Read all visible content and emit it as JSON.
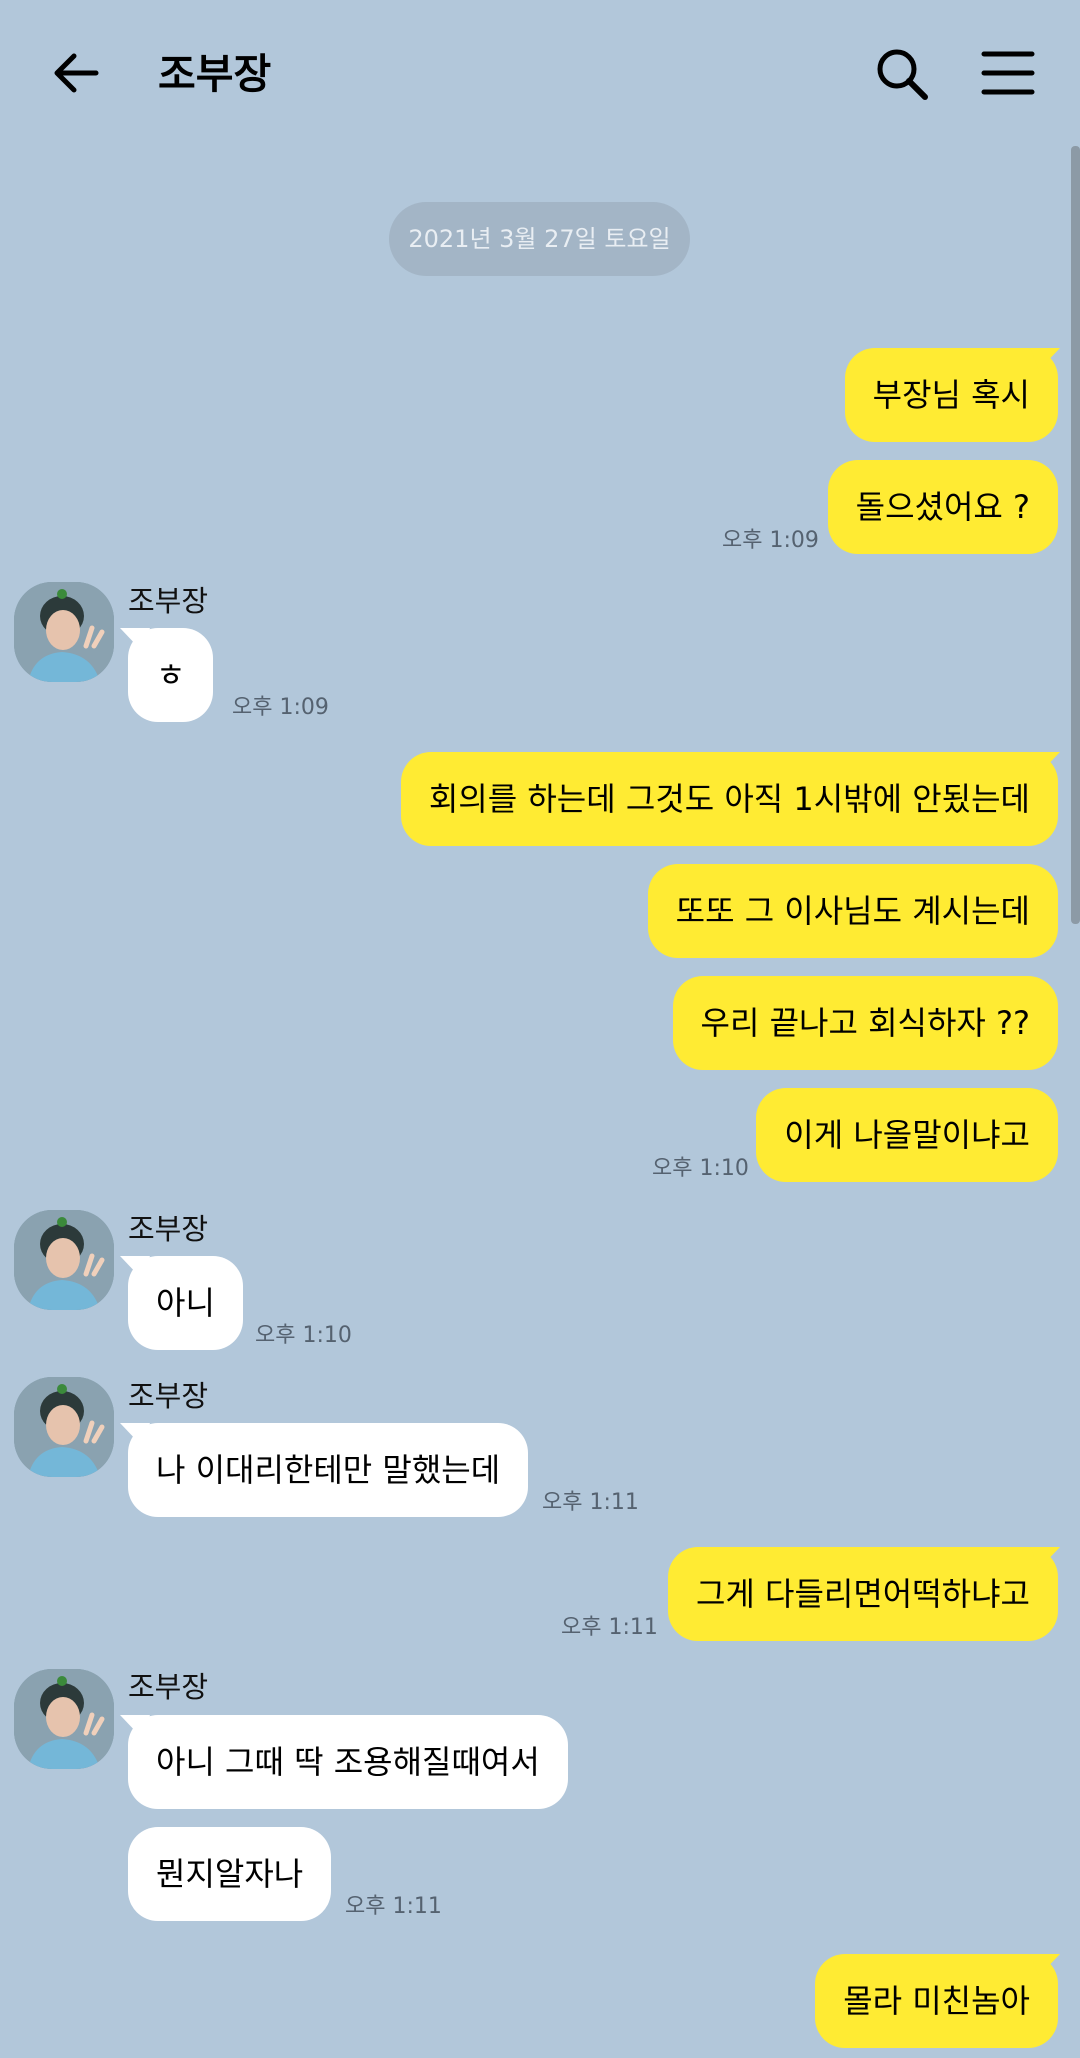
{
  "header": {
    "title": "조부장"
  },
  "date_divider": "2021년 3월 27일 토요일",
  "messages": {
    "m1": {
      "text": "부장님 혹시"
    },
    "m2": {
      "text": "돌으셨어요 ?",
      "time": "오후 1:09"
    },
    "g1": {
      "sender": "조부장",
      "text": "ㅎ",
      "time": "오후 1:09"
    },
    "m3": {
      "text": "회의를 하는데 그것도 아직 1시밖에 안됬는데"
    },
    "m4": {
      "text": "또또 그 이사님도 계시는데"
    },
    "m5": {
      "text": "우리 끝나고 회식하자 ??"
    },
    "m6": {
      "text": "이게 나올말이냐고",
      "time": "오후 1:10"
    },
    "g2": {
      "sender": "조부장",
      "text": "아니",
      "time": "오후 1:10"
    },
    "g3": {
      "sender": "조부장",
      "text": "나 이대리한테만 말했는데",
      "time": "오후 1:11"
    },
    "m7": {
      "text": "그게 다들리면어떡하냐고",
      "time": "오후 1:11"
    },
    "g4": {
      "sender": "조부장",
      "text": "아니 그때 딱 조용해질때여서"
    },
    "g5": {
      "text": "뭔지알자나",
      "time": "오후 1:11"
    },
    "m8": {
      "text": "몰라 미친놈아"
    }
  },
  "colors": {
    "background": "#b2c7da",
    "my_bubble": "#ffeb33",
    "their_bubble": "#ffffff"
  },
  "icons": {
    "back": "arrow-left-icon",
    "search": "search-icon",
    "menu": "menu-icon"
  }
}
